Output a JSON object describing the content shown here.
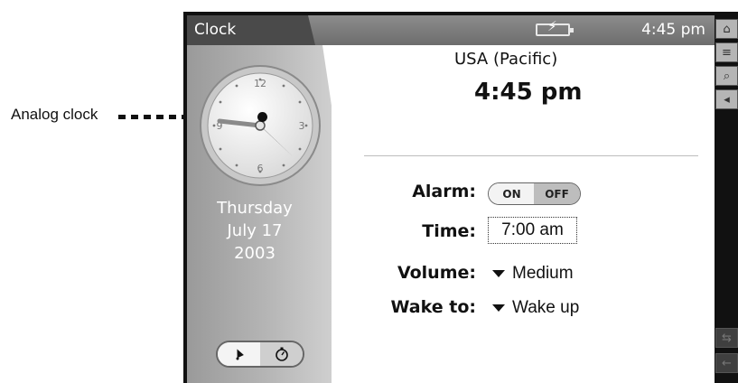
{
  "callout": {
    "label": "Analog clock"
  },
  "app": {
    "title": "Clock",
    "status_time": "4:45 pm",
    "battery_icon": "battery-charging-icon"
  },
  "clock_face": {
    "numerals": [
      "12",
      "3",
      "6",
      "9"
    ],
    "hour_value": 4,
    "minute_value": 45
  },
  "date": {
    "weekday": "Thursday",
    "month_day": "July 17",
    "year": "2003"
  },
  "mode_buttons": {
    "alarm_icon": "bell-icon",
    "stopwatch_icon": "stopwatch-icon"
  },
  "main": {
    "timezone": "USA (Pacific)",
    "time": "4:45 pm"
  },
  "settings": {
    "alarm_label": "Alarm:",
    "alarm_on": "ON",
    "alarm_off": "OFF",
    "time_label": "Time:",
    "time_value": "7:00 am",
    "volume_label": "Volume:",
    "volume_value": "Medium",
    "wake_label": "Wake to:",
    "wake_value": "Wake up"
  },
  "sidebar": {
    "icons": [
      "home-icon",
      "menu-icon",
      "search-icon",
      "speaker-icon",
      "sync-icon",
      "back-icon"
    ]
  },
  "colors": {
    "titlebar": "#777777",
    "panel_gray": "#b5b5b5",
    "text": "#111111"
  }
}
